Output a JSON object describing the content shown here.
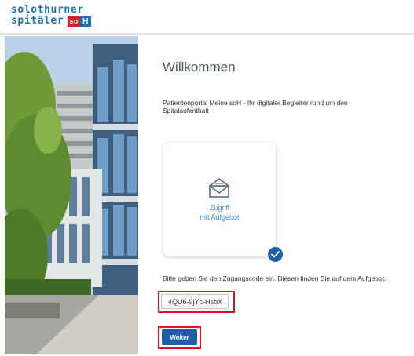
{
  "header": {
    "logo_line1": "solothurner",
    "logo_line2": "spitäler",
    "logo_badge_so": "so",
    "logo_badge_h": "H"
  },
  "main": {
    "title": "Willkommen",
    "intro": "Patientenportal Meine soH - Ihr digitaler Begleiter rund um den Spitalaufenthalt",
    "card": {
      "label_line1": "Zugriff",
      "label_line2": "mit Aufgebot",
      "icon": "envelope-open-icon",
      "selected": true
    },
    "code_hint": "Bitte geben Sie den Zugangscode ein. Diesen finden Sie auf dem Aufgebot.",
    "code_value": "4QU6-9jYc-HsbX",
    "submit_label": "Weiter"
  },
  "colors": {
    "brand_blue": "#1d6fb1",
    "brand_red": "#d92028",
    "button_blue": "#1f5fa9",
    "link_blue": "#3a8ad3",
    "highlight_red": "#e0151b"
  }
}
